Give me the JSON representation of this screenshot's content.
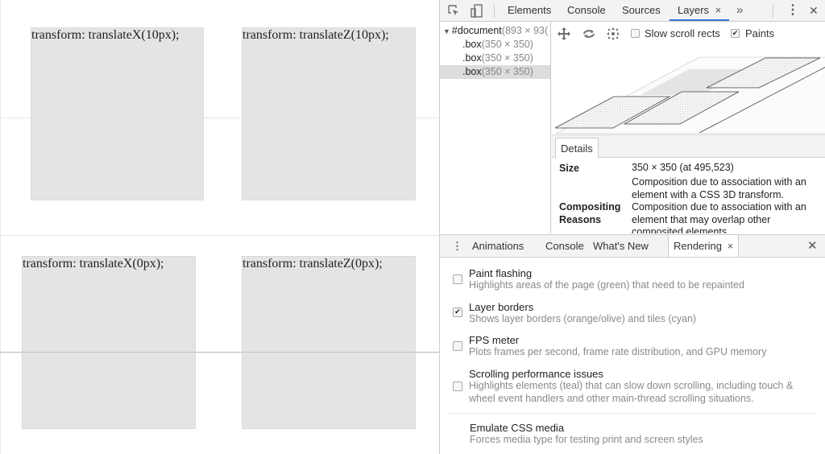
{
  "page": {
    "boxes": [
      {
        "label": "transform: translateX(10px);"
      },
      {
        "label": "transform: translateZ(10px);"
      },
      {
        "label": "transform: translateX(0px);"
      },
      {
        "label": "transform: translateZ(0px);"
      }
    ],
    "colors": {
      "box_fill": "#e4e4e4",
      "tile_line": "#d7e8ee"
    }
  },
  "devtools": {
    "toolbar": {
      "inspect_icon": "inspect-element-icon",
      "device_icon": "device-toolbar-icon",
      "tabs": [
        {
          "label": "Elements"
        },
        {
          "label": "Console"
        },
        {
          "label": "Sources"
        },
        {
          "label": "Layers",
          "active": true,
          "close": "×"
        }
      ],
      "more_tabs": "»",
      "menu": "⋮",
      "close": "✕"
    },
    "layers_tree": [
      {
        "name": "#document",
        "size": "(893 × 93("
      },
      {
        "name": ".box",
        "size": "(350 × 350)"
      },
      {
        "name": ".box",
        "size": "(350 × 350)"
      },
      {
        "name": ".box",
        "size": "(350 × 350)",
        "selected": true
      }
    ],
    "layer_toolbar": {
      "pan_icon": "pan-mode-icon",
      "rotate_icon": "rotate-mode-icon",
      "reset_icon": "reset-transform-icon",
      "slow_scroll_label": "Slow scroll rects",
      "slow_scroll_checked": false,
      "paints_label": "Paints",
      "paints_checked": true
    },
    "details": {
      "tab": "Details",
      "size_key": "Size",
      "size_value": "350 × 350 (at 495,523)",
      "reasons_key_1": "Compositing",
      "reasons_key_2": "Reasons",
      "reasons": [
        "Composition due to association with an element with a CSS 3D transform.",
        "Composition due to association with an element that may overlap other composited elements."
      ]
    },
    "drawer": {
      "menu": "⋮",
      "tabs": [
        {
          "label": "Animations"
        },
        {
          "label": "Console"
        },
        {
          "label": "What's New"
        },
        {
          "label": "Rendering",
          "active": true,
          "close": "×"
        }
      ],
      "close": "✕"
    },
    "rendering": {
      "options": [
        {
          "title": "Paint flashing",
          "desc": "Highlights areas of the page (green) that need to be repainted",
          "checked": false
        },
        {
          "title": "Layer borders",
          "desc": "Shows layer borders (orange/olive) and tiles (cyan)",
          "checked": true
        },
        {
          "title": "FPS meter",
          "desc": "Plots frames per second, frame rate distribution, and GPU memory",
          "checked": false
        },
        {
          "title": "Scrolling performance issues",
          "desc": "Highlights elements (teal) that can slow down scrolling, including touch & wheel event handlers and other main-thread scrolling situations.",
          "checked": false
        }
      ],
      "emulate_title": "Emulate CSS media",
      "emulate_desc": "Forces media type for testing print and screen styles"
    }
  }
}
